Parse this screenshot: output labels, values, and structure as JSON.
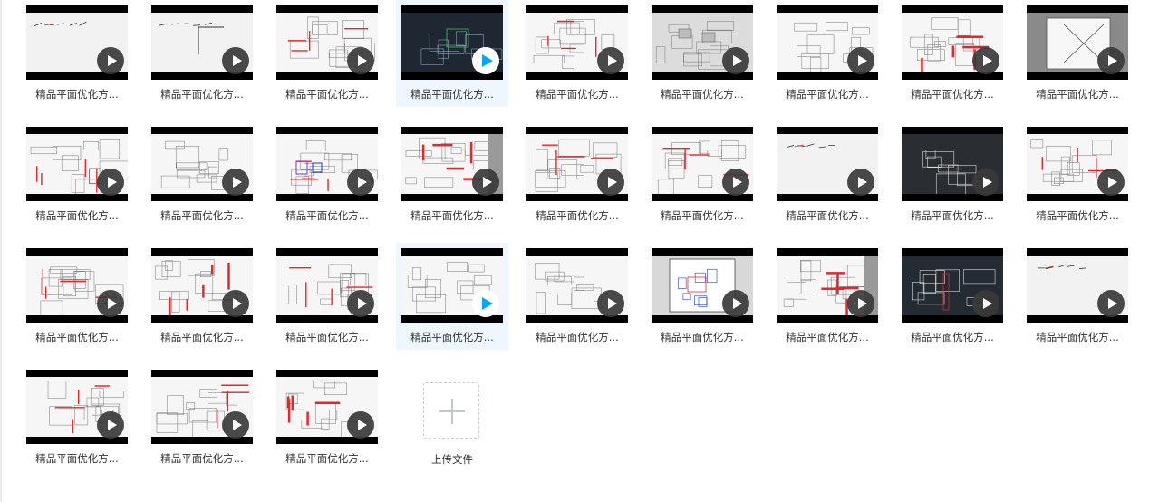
{
  "videos": [
    {
      "title": "精品平面优化方...",
      "style": "sketch",
      "selected": false
    },
    {
      "title": "精品平面优化方...",
      "style": "sketch2",
      "selected": false
    },
    {
      "title": "精品平面优化方...",
      "style": "plan",
      "selected": false
    },
    {
      "title": "精品平面优化方...",
      "style": "cad",
      "selected": true
    },
    {
      "title": "精品平面优化方...",
      "style": "plan",
      "selected": false
    },
    {
      "title": "精品平面优化方...",
      "style": "grayplan",
      "selected": false
    },
    {
      "title": "精品平面优化方...",
      "style": "bwplan",
      "selected": false
    },
    {
      "title": "精品平面优化方...",
      "style": "redwall",
      "selected": false
    },
    {
      "title": "精品平面优化方...",
      "style": "diagram",
      "selected": false
    },
    {
      "title": "精品平面优化方...",
      "style": "plan",
      "selected": false
    },
    {
      "title": "精品平面优化方...",
      "style": "bwplan",
      "selected": false
    },
    {
      "title": "精品平面优化方...",
      "style": "colorplan",
      "selected": false
    },
    {
      "title": "精品平面优化方...",
      "style": "redwall",
      "selected": false
    },
    {
      "title": "精品平面优化方...",
      "style": "plan",
      "selected": false
    },
    {
      "title": "精品平面优化方...",
      "style": "plan",
      "selected": false
    },
    {
      "title": "精品平面优化方...",
      "style": "sketch",
      "selected": false
    },
    {
      "title": "精品平面优化方...",
      "style": "darkplan",
      "selected": false
    },
    {
      "title": "精品平面优化方...",
      "style": "plan",
      "selected": false
    },
    {
      "title": "精品平面优化方...",
      "style": "plan",
      "selected": false
    },
    {
      "title": "精品平面优化方...",
      "style": "redwall",
      "selected": false
    },
    {
      "title": "精品平面优化方...",
      "style": "plan",
      "selected": false
    },
    {
      "title": "精品平面优化方...",
      "style": "bwplan",
      "selected": true
    },
    {
      "title": "精品平面优化方...",
      "style": "bwplan",
      "selected": false
    },
    {
      "title": "精品平面优化方...",
      "style": "paper",
      "selected": false
    },
    {
      "title": "精品平面优化方...",
      "style": "redwall",
      "selected": false
    },
    {
      "title": "精品平面优化方...",
      "style": "dark",
      "selected": false
    },
    {
      "title": "精品平面优化方...",
      "style": "sketch",
      "selected": false
    },
    {
      "title": "精品平面优化方...",
      "style": "plan",
      "selected": false
    },
    {
      "title": "精品平面优化方...",
      "style": "plan",
      "selected": false
    },
    {
      "title": "精品平面优化方...",
      "style": "redwall",
      "selected": false
    }
  ],
  "upload": {
    "label": "上传文件"
  },
  "colors": {
    "accent": "#06a7ff",
    "play_bg": "#3a3a3a",
    "plan_red": "#e8262a"
  }
}
